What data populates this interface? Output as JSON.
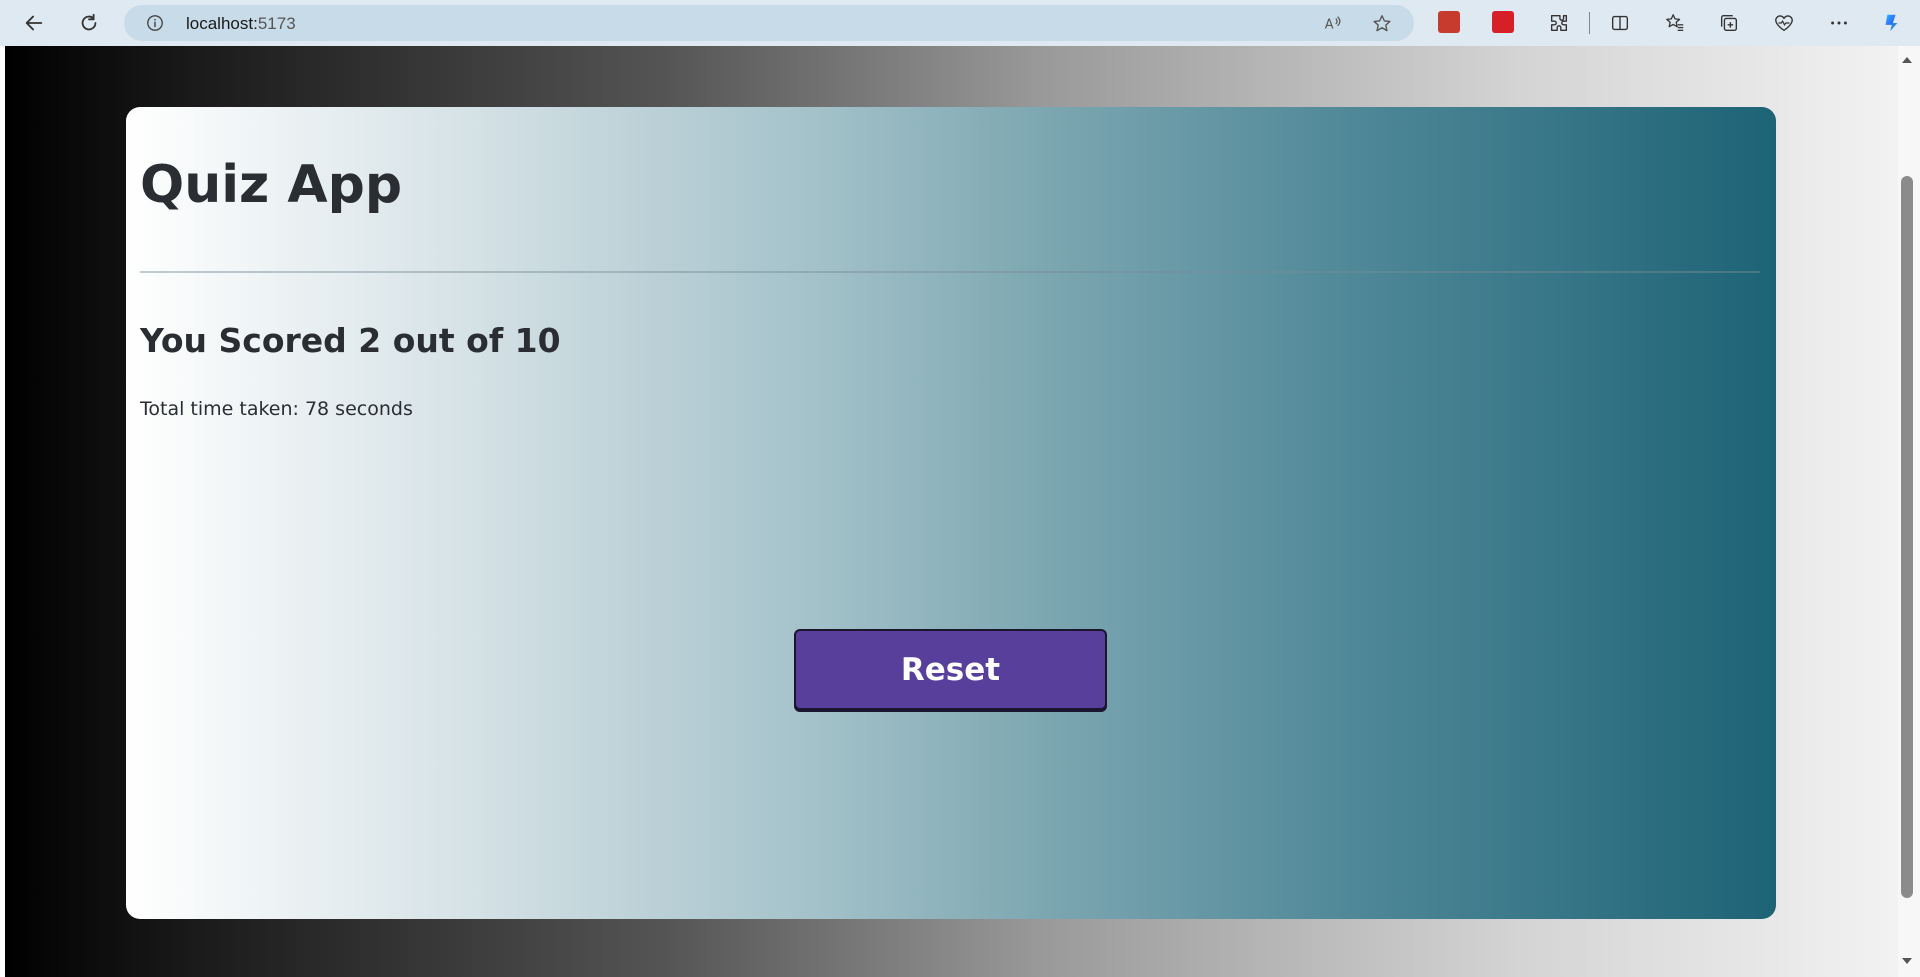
{
  "browser": {
    "url_host": "localhost:",
    "url_port": "5173",
    "colors": {
      "toolbar": "#dfe9f1",
      "addressbar": "#c8dbe8"
    }
  },
  "app": {
    "title": "Quiz App",
    "score_text": "You Scored 2 out of 10",
    "time_text": "Total time taken: 78 seconds",
    "reset_label": "Reset",
    "colors": {
      "reset_button": "#583f9b",
      "card_gradient_start": "#ffffff",
      "card_gradient_end": "#1d6376",
      "text": "#2a2e33"
    }
  }
}
